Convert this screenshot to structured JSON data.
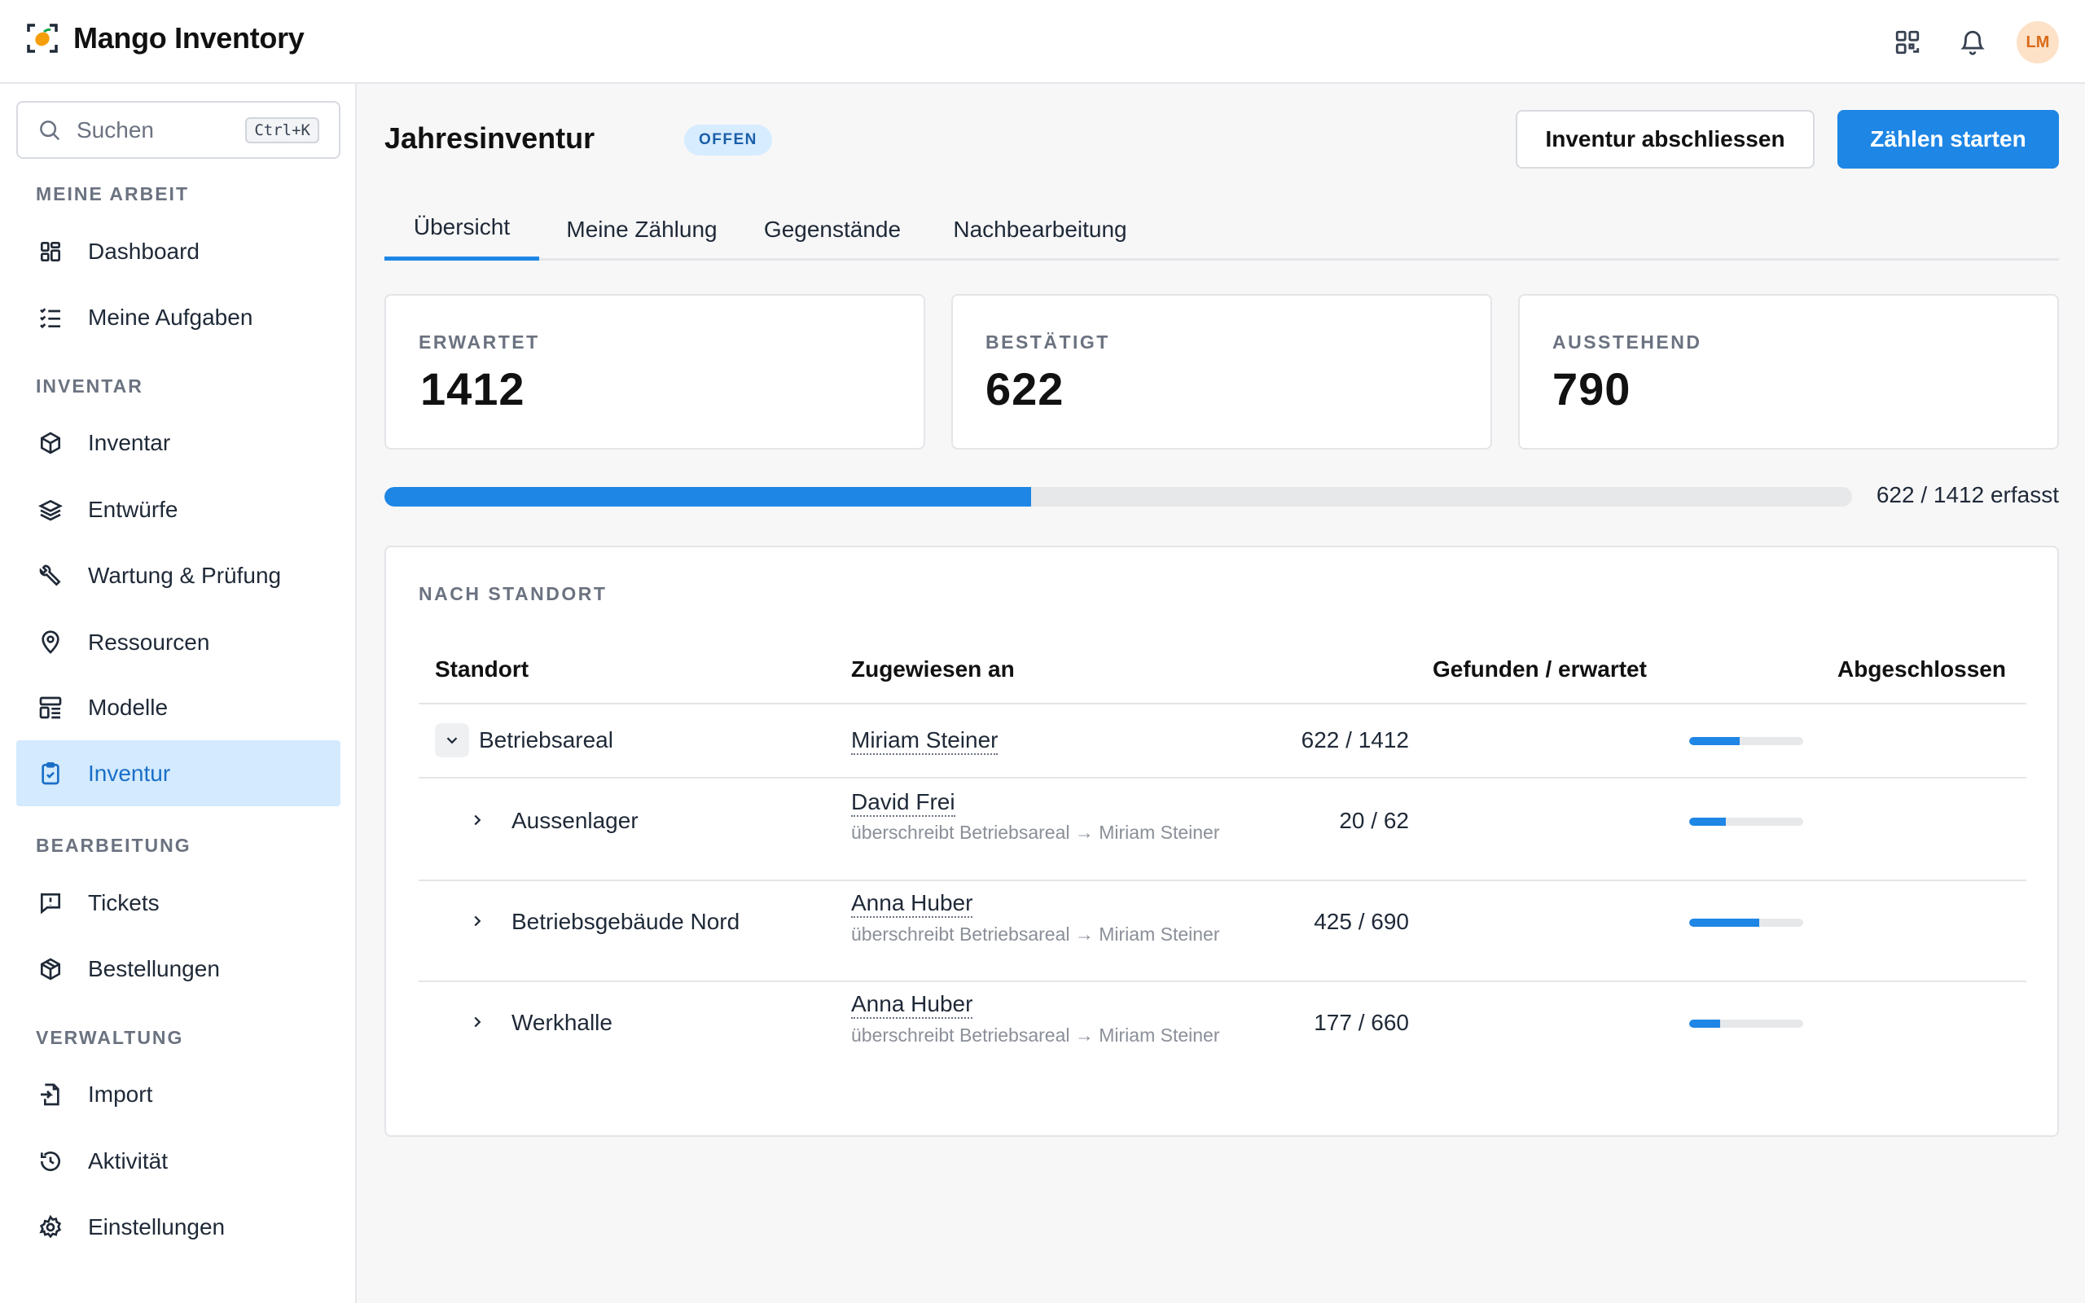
{
  "app": {
    "name": "Mango Inventory",
    "avatar_initials": "LM"
  },
  "search": {
    "placeholder": "Suchen",
    "shortcut": "Ctrl+K"
  },
  "sidebar": {
    "sections": [
      {
        "title": "MEINE ARBEIT",
        "items": [
          {
            "label": "Dashboard",
            "icon": "dashboard-icon"
          },
          {
            "label": "Meine Aufgaben",
            "icon": "tasks-icon"
          }
        ]
      },
      {
        "title": "INVENTAR",
        "items": [
          {
            "label": "Inventar",
            "icon": "box-icon"
          },
          {
            "label": "Entwürfe",
            "icon": "layers-icon"
          },
          {
            "label": "Wartung & Prüfung",
            "icon": "wrench-icon"
          },
          {
            "label": "Ressourcen",
            "icon": "location-pin-icon"
          },
          {
            "label": "Modelle",
            "icon": "template-icon"
          },
          {
            "label": "Inventur",
            "icon": "clipboard-check-icon",
            "active": true
          }
        ]
      },
      {
        "title": "BEARBEITUNG",
        "items": [
          {
            "label": "Tickets",
            "icon": "message-alert-icon"
          },
          {
            "label": "Bestellungen",
            "icon": "package-icon"
          }
        ]
      },
      {
        "title": "VERWALTUNG",
        "items": [
          {
            "label": "Import",
            "icon": "file-import-icon"
          },
          {
            "label": "Aktivität",
            "icon": "history-icon"
          },
          {
            "label": "Einstellungen",
            "icon": "gear-icon"
          }
        ]
      }
    ]
  },
  "page": {
    "title": "Jahresinventur",
    "status": "OFFEN",
    "btn_close": "Inventur abschliessen",
    "btn_start": "Zählen starten",
    "tabs": [
      "Übersicht",
      "Meine Zählung",
      "Gegenstände",
      "Nachbearbeitung"
    ],
    "active_tab": 0
  },
  "stats": [
    {
      "label": "ERWARTET",
      "value": "1412"
    },
    {
      "label": "BESTÄTIGT",
      "value": "622"
    },
    {
      "label": "AUSSTEHEND",
      "value": "790"
    }
  ],
  "progress": {
    "found": 622,
    "expected": 1412,
    "text": "622 / 1412 erfasst"
  },
  "by_location": {
    "title": "NACH STANDORT",
    "headers": {
      "location": "Standort",
      "assigned": "Zugewiesen an",
      "found": "Gefunden / erwartet",
      "done": "Abgeschlossen"
    },
    "rows": [
      {
        "location": "Betriebsareal",
        "assignee": "Miriam Steiner",
        "note": "",
        "found": 622,
        "expected": 1412,
        "ratio": "622 / 1412",
        "expanded": true,
        "level": 0
      },
      {
        "location": "Aussenlager",
        "assignee": "David Frei",
        "note": "überschreibt Betriebsareal → Miriam Steiner",
        "found": 20,
        "expected": 62,
        "ratio": "20 / 62",
        "expanded": false,
        "level": 1
      },
      {
        "location": "Betriebsgebäude Nord",
        "assignee": "Anna Huber",
        "note": "überschreibt Betriebsareal → Miriam Steiner",
        "found": 425,
        "expected": 690,
        "ratio": "425 / 690",
        "expanded": false,
        "level": 1
      },
      {
        "location": "Werkhalle",
        "assignee": "Anna Huber",
        "note": "überschreibt Betriebsareal → Miriam Steiner",
        "found": 177,
        "expected": 660,
        "ratio": "177 / 660",
        "expanded": false,
        "level": 1
      }
    ]
  },
  "colors": {
    "accent": "#1e86e5",
    "active_bg": "#d3eaff",
    "badge_bg": "#d7ecff"
  }
}
